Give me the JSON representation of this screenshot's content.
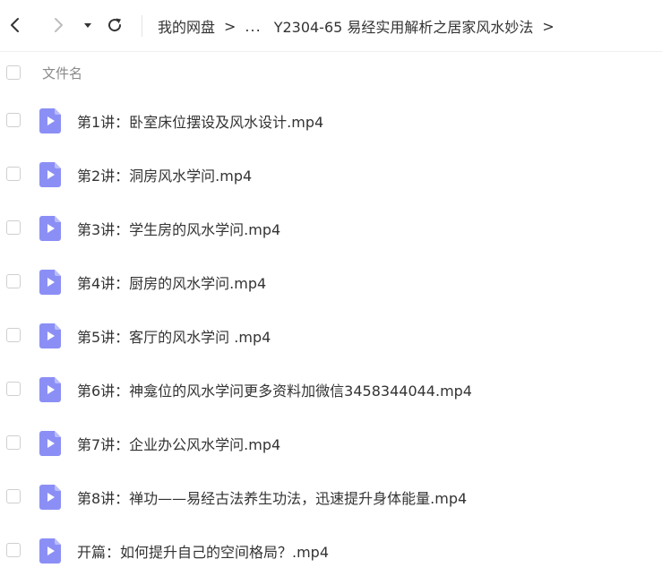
{
  "toolbar": {
    "back_icon": "chevron-left-icon",
    "forward_icon": "chevron-right-icon",
    "dropdown_icon": "caret-down-icon",
    "refresh_icon": "refresh-icon"
  },
  "breadcrumb": {
    "root": "我的网盘",
    "separator": ">",
    "ellipsis": "...",
    "current": "Y2304-65 易经实用解析之居家风水妙法",
    "trailing_separator": ">"
  },
  "list_header": {
    "name_column": "文件名"
  },
  "colors": {
    "file_icon": "#8b8ff5",
    "file_icon_fold": "#b9bcfa"
  },
  "files": [
    {
      "name": "第1讲：卧室床位摆设及风水设计.mp4",
      "icon": "video-file-icon"
    },
    {
      "name": "第2讲：洞房风水学问.mp4",
      "icon": "video-file-icon"
    },
    {
      "name": "第3讲：学生房的风水学问.mp4",
      "icon": "video-file-icon"
    },
    {
      "name": "第4讲：厨房的风水学问.mp4",
      "icon": "video-file-icon"
    },
    {
      "name": "第5讲：客厅的风水学问 .mp4",
      "icon": "video-file-icon"
    },
    {
      "name": "第6讲：神龛位的风水学问更多资料加微信3458344044.mp4",
      "icon": "video-file-icon"
    },
    {
      "name": "第7讲：企业办公风水学问.mp4",
      "icon": "video-file-icon"
    },
    {
      "name": "第8讲：禅功——易经古法养生功法，迅速提升身体能量.mp4",
      "icon": "video-file-icon"
    },
    {
      "name": "开篇：如何提升自己的空间格局？.mp4",
      "icon": "video-file-icon"
    }
  ]
}
